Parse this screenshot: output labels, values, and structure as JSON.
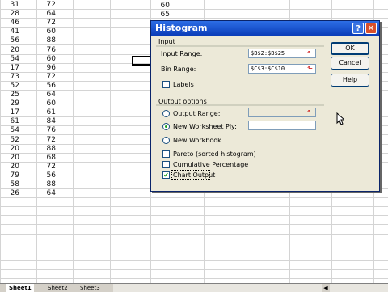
{
  "sheet": {
    "rows": [
      [
        "31",
        "72"
      ],
      [
        "28",
        "64"
      ],
      [
        "46",
        "72"
      ],
      [
        "41",
        "60"
      ],
      [
        "56",
        "88"
      ],
      [
        "20",
        "76"
      ],
      [
        "54",
        "60"
      ],
      [
        "17",
        "96"
      ],
      [
        "73",
        "72"
      ],
      [
        "52",
        "56"
      ],
      [
        "25",
        "64"
      ],
      [
        "29",
        "60"
      ],
      [
        "17",
        "61"
      ],
      [
        "61",
        "84"
      ],
      [
        "54",
        "76"
      ],
      [
        "52",
        "72"
      ],
      [
        "20",
        "88"
      ],
      [
        "20",
        "68"
      ],
      [
        "20",
        "72"
      ],
      [
        "79",
        "56"
      ],
      [
        "58",
        "88"
      ],
      [
        "26",
        "64"
      ]
    ],
    "col_c": [
      "60",
      "65"
    ],
    "tabs": [
      "Sheet1",
      "Sheet2",
      "Sheet3"
    ]
  },
  "dialog": {
    "title": "Histogram",
    "input_group": "Input",
    "input_range_label": "Input Range:",
    "input_range_value": "$B$2:$B$25",
    "bin_range_label": "Bin Range:",
    "bin_range_value": "$C$3:$C$10",
    "labels_label": "Labels",
    "output_group": "Output options",
    "output_range_label": "Output Range:",
    "new_worksheet_label": "New Worksheet Ply:",
    "new_workbook_label": "New Workbook",
    "pareto_label": "Pareto (sorted histogram)",
    "cumulative_label": "Cumulative Percentage",
    "chart_output_label": "Chart Output",
    "ok_label": "OK",
    "cancel_label": "Cancel",
    "help_label": "Help",
    "help_glyph": "?",
    "close_glyph": "✕",
    "collapse_glyph": "⬑"
  },
  "colors": {
    "title_bar": "#0a3cb8",
    "dialog_bg": "#ece9d8",
    "checkmark": "#21a121"
  }
}
